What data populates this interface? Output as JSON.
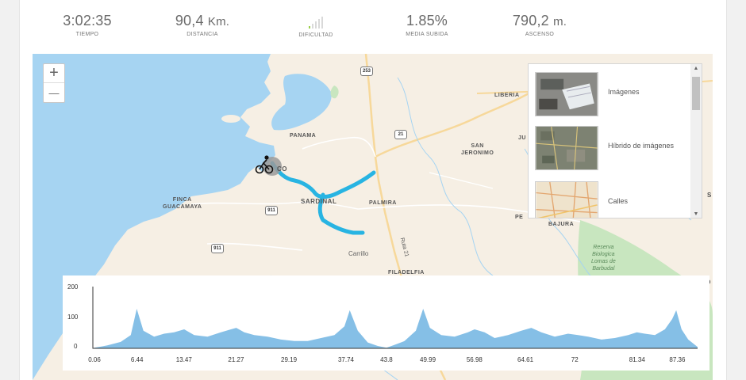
{
  "stats": [
    {
      "value": "3:02:35",
      "unit": "",
      "label": "TIEMPO"
    },
    {
      "value": "90,4",
      "unit": "Km.",
      "label": "DISTANCIA"
    },
    {
      "value": "",
      "unit": "",
      "label": "DIFICULTAD",
      "difficulty_level": 1,
      "difficulty_max": 5
    },
    {
      "value": "1.85%",
      "unit": "",
      "label": "MEDIA SUBIDA"
    },
    {
      "value": "790,2",
      "unit": "m.",
      "label": "ASCENSO"
    }
  ],
  "map": {
    "zoom_in": "+",
    "zoom_out": "—",
    "labels": {
      "panama": "PANAMA",
      "liberia": "LIBERIA",
      "san_jeronimo": "SAN\nJERONIMO",
      "finca": "FINCA\nGUACAMAYA",
      "sardinal": "SARDINAL",
      "palmira": "PALMIRA",
      "carrillo": "Carrillo",
      "filadelfia": "FILADELFIA",
      "coco": "CO",
      "ju": "JU",
      "pe": "PE",
      "bajura": "BAJURA",
      "ruta": "Ruta 21",
      "reserva": "Reserva\nBiologica\nLomas de\nBarbudal",
      "edge_s": "S",
      "edge_do": "DO"
    },
    "shields": [
      "253",
      "21",
      "911",
      "911"
    ],
    "colors": {
      "water": "#a6d4f2",
      "land": "#f6efe4",
      "route": "#28b4e2",
      "park": "#c8e6bf"
    }
  },
  "layers": {
    "items": [
      {
        "name": "Imágenes",
        "icon": "satellite-thumb"
      },
      {
        "name": "Híbrido de imágenes",
        "icon": "hybrid-thumb"
      },
      {
        "name": "Calles",
        "icon": "streets-thumb"
      }
    ],
    "scroll_up": "▲",
    "scroll_down": "▼"
  },
  "chart_data": {
    "type": "area",
    "title": "",
    "xlabel": "",
    "ylabel": "",
    "ylim": [
      0,
      200
    ],
    "yticks": [
      "0",
      "100",
      "200"
    ],
    "x_tick_labels": [
      "0.06",
      "6.44",
      "13.47",
      "21.27",
      "29.19",
      "37.74",
      "43.8",
      "49.99",
      "56.98",
      "64.61",
      "72",
      "81.34",
      "87.36"
    ],
    "series": [
      {
        "color": "#85bfe6",
        "x": [
          0.06,
          2,
          4,
          5.5,
          6.4,
          7.4,
          9,
          10.5,
          12,
          13.5,
          15,
          17,
          19,
          20.5,
          21.3,
          22.5,
          24,
          26,
          28,
          30,
          32,
          34,
          36,
          37.5,
          38.3,
          39.5,
          41,
          42.5,
          43.8,
          45,
          46.5,
          48.2,
          49.3,
          50.3,
          52,
          54,
          56,
          57,
          58.5,
          60,
          62,
          64,
          65.5,
          67,
          69,
          71,
          72.5,
          74,
          76,
          78,
          80,
          81.3,
          82.5,
          84,
          85.5,
          86.6,
          87.2,
          88,
          89,
          90.4
        ],
        "y": [
          2,
          10,
          22,
          45,
          135,
          60,
          40,
          50,
          55,
          65,
          45,
          40,
          55,
          65,
          70,
          55,
          45,
          40,
          30,
          25,
          25,
          35,
          45,
          75,
          130,
          60,
          20,
          8,
          2,
          12,
          25,
          60,
          135,
          70,
          45,
          40,
          55,
          65,
          55,
          35,
          45,
          60,
          70,
          55,
          40,
          50,
          45,
          40,
          30,
          35,
          45,
          55,
          50,
          45,
          65,
          100,
          130,
          65,
          30,
          5
        ]
      }
    ]
  }
}
